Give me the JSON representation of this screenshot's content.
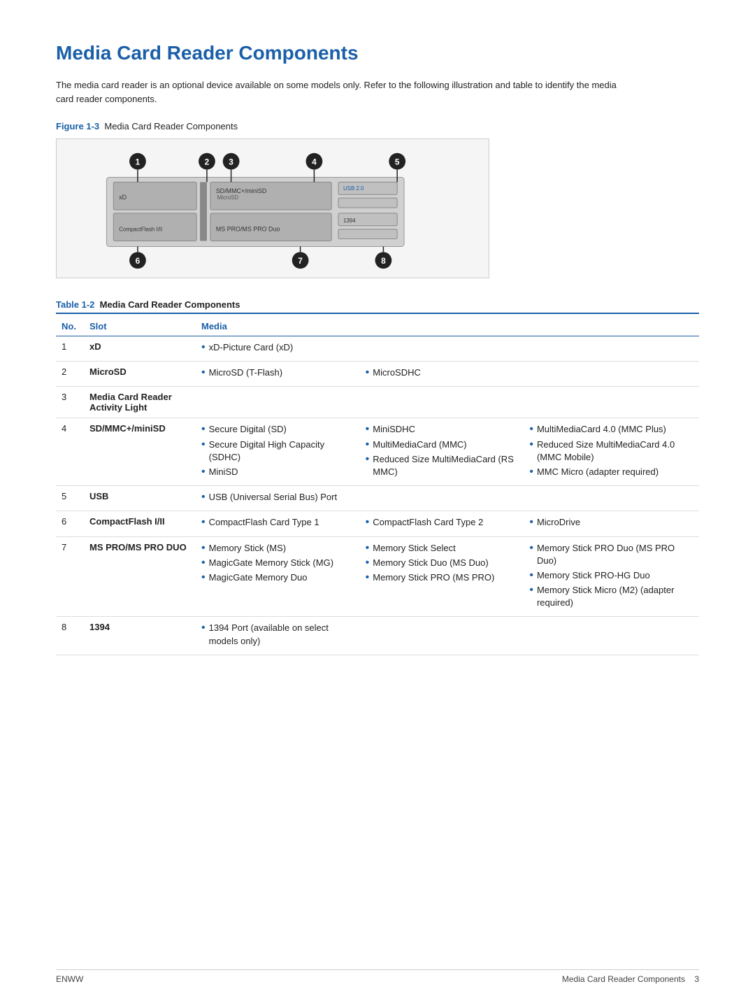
{
  "page": {
    "title": "Media Card Reader Components",
    "intro": "The media card reader is an optional device available on some models only. Refer to the following illustration and table to identify the media card reader components.",
    "figure_label": "Figure 1-3",
    "figure_caption": "Media Card Reader Components",
    "table_label": "Table 1-2",
    "table_caption": "Media Card Reader Components",
    "footer_left": "ENWW",
    "footer_right": "Media Card Reader Components",
    "footer_page": "3"
  },
  "table": {
    "headers": {
      "no": "No.",
      "slot": "Slot",
      "media": "Media"
    },
    "rows": [
      {
        "no": "1",
        "slot": "xD",
        "media_cols": [
          [
            "xD-Picture Card (xD)"
          ],
          [],
          []
        ]
      },
      {
        "no": "2",
        "slot": "MicroSD",
        "media_cols": [
          [
            "MicroSD (T-Flash)"
          ],
          [
            "MicroSDHC"
          ],
          []
        ]
      },
      {
        "no": "3",
        "slot": "Media Card Reader Activity Light",
        "media_cols": [
          [],
          [],
          []
        ]
      },
      {
        "no": "4",
        "slot": "SD/MMC+/miniSD",
        "media_cols": [
          [
            "Secure Digital (SD)",
            "Secure Digital High Capacity (SDHC)",
            "MiniSD"
          ],
          [
            "MiniSDHC",
            "MultiMediaCard (MMC)",
            "Reduced Size MultiMediaCard (RS MMC)"
          ],
          [
            "MultiMediaCard 4.0 (MMC Plus)",
            "Reduced Size MultiMediaCard 4.0 (MMC Mobile)",
            "MMC Micro (adapter required)"
          ]
        ]
      },
      {
        "no": "5",
        "slot": "USB",
        "media_cols": [
          [
            "USB (Universal Serial Bus) Port"
          ],
          [],
          []
        ]
      },
      {
        "no": "6",
        "slot": "CompactFlash I/II",
        "media_cols": [
          [
            "CompactFlash Card Type 1"
          ],
          [
            "CompactFlash Card Type 2"
          ],
          [
            "MicroDrive"
          ]
        ]
      },
      {
        "no": "7",
        "slot": "MS PRO/MS PRO DUO",
        "media_cols": [
          [
            "Memory Stick (MS)",
            "MagicGate Memory Stick (MG)",
            "MagicGate Memory Duo"
          ],
          [
            "Memory Stick Select",
            "Memory Stick Duo (MS Duo)",
            "Memory Stick PRO (MS PRO)"
          ],
          [
            "Memory Stick PRO Duo (MS PRO Duo)",
            "Memory Stick PRO-HG Duo",
            "Memory Stick Micro (M2) (adapter required)"
          ]
        ]
      },
      {
        "no": "8",
        "slot": "1394",
        "media_cols": [
          [
            "1394 Port (available on select models only)"
          ],
          [],
          []
        ]
      }
    ]
  }
}
